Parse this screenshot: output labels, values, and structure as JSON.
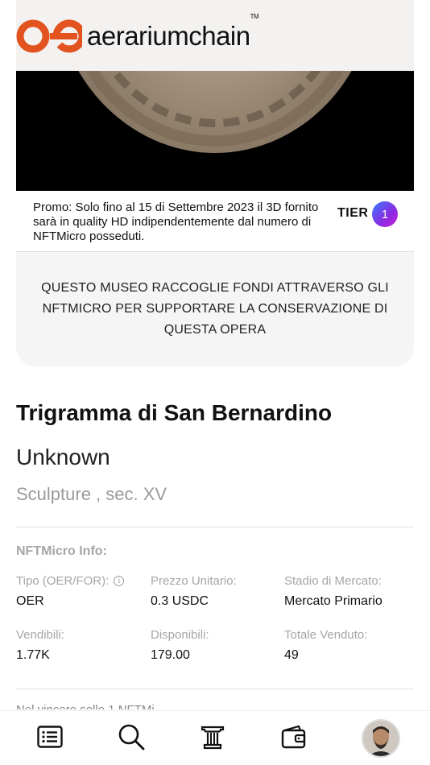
{
  "brand": {
    "name": "aerariumchain",
    "trademark": "TM",
    "colors": {
      "orange": "#e2531f",
      "text": "#111111"
    }
  },
  "promo": {
    "text": "Promo: Solo fino al 15 di Settembre 2023 il 3D fornito sarà in quality HD indipendentemente dal numero di NFTMicro posseduti.",
    "tier_label": "TIER",
    "tier_value": "1"
  },
  "museum_notice": "QUESTO MUSEO RACCOGLIE FONDI ATTRAVERSO GLI NFTMICRO PER SUPPORTARE LA CONSERVAZIONE DI QUESTA OPERA",
  "artwork": {
    "title": "Trigramma di San Bernardino",
    "author": "Unknown",
    "category": "Sculpture , sec. XV"
  },
  "nftmicro_info": {
    "header": "NFTMicro Info:",
    "fields": [
      {
        "label": "Tipo (OER/FOR):",
        "value": "OER",
        "has_info_icon": true
      },
      {
        "label": "Prezzo Unitario:",
        "value": "0.3 USDC"
      },
      {
        "label": "Stadio di Mercato:",
        "value": "Mercato Primario"
      },
      {
        "label": "Vendibili:",
        "value": "1.77K"
      },
      {
        "label": "Disponibili:",
        "value": "179.00"
      },
      {
        "label": "Totale Venduto:",
        "value": "49"
      }
    ]
  },
  "partial_text": "Nel vincere sollo 1 NFTMi",
  "bottom_nav": [
    {
      "icon": "list-icon"
    },
    {
      "icon": "search-icon"
    },
    {
      "icon": "column-icon"
    },
    {
      "icon": "wallet-icon"
    },
    {
      "icon": "avatar"
    }
  ]
}
